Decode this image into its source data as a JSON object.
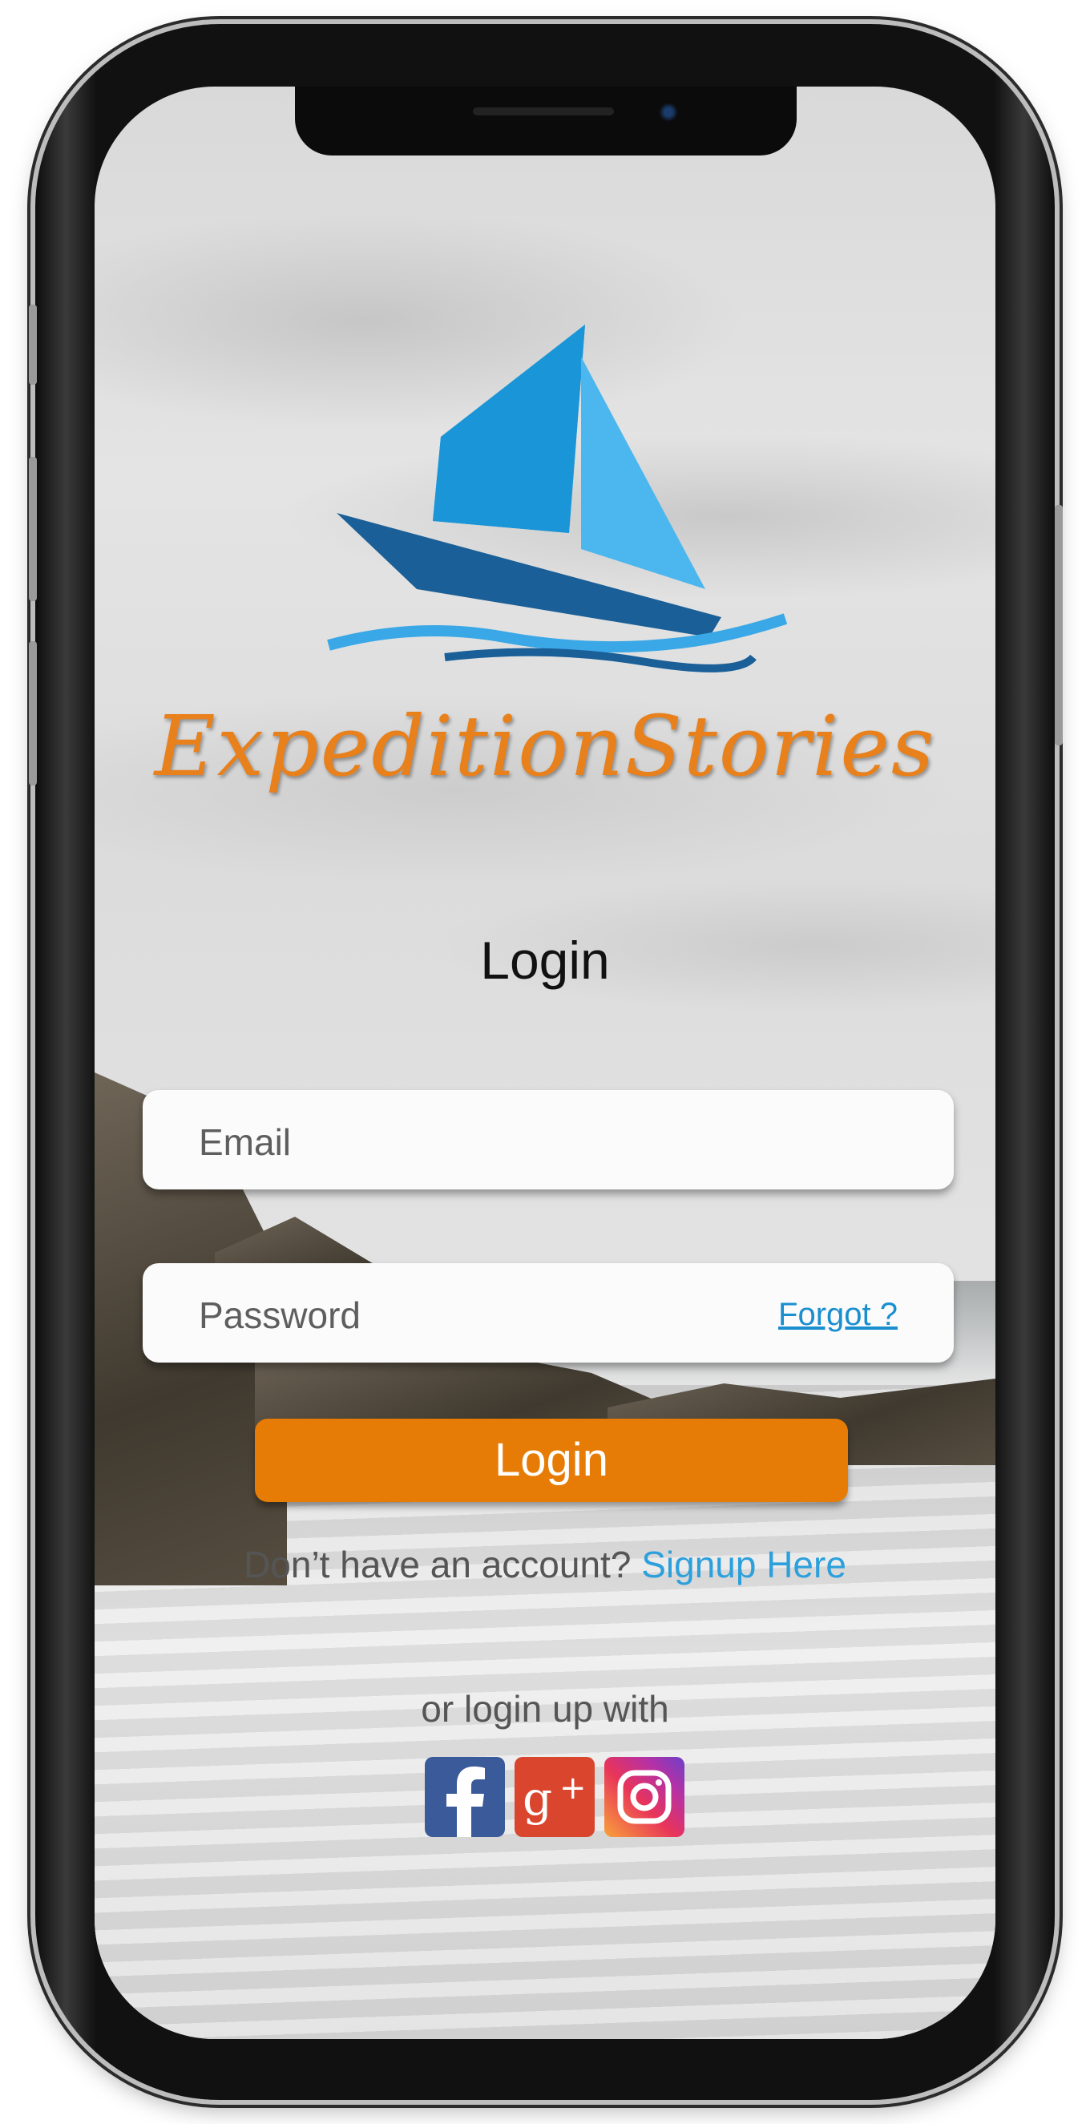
{
  "app": {
    "brand_name": "ExpeditionStories",
    "brand_color": "#e8801c",
    "logo_icon": "sailboat-logo-icon"
  },
  "login": {
    "title": "Login",
    "email_placeholder": "Email",
    "password_placeholder": "Password",
    "forgot_label": "Forgot ?",
    "button_label": "Login",
    "button_color": "#e67c05"
  },
  "signup": {
    "prompt": "Don’t have an account?",
    "link_label": "Signup Here"
  },
  "social": {
    "heading": "or login up with",
    "providers": [
      {
        "name": "Facebook",
        "icon": "facebook-icon"
      },
      {
        "name": "Google Plus",
        "icon": "google-plus-icon"
      },
      {
        "name": "Instagram",
        "icon": "instagram-icon"
      }
    ]
  }
}
